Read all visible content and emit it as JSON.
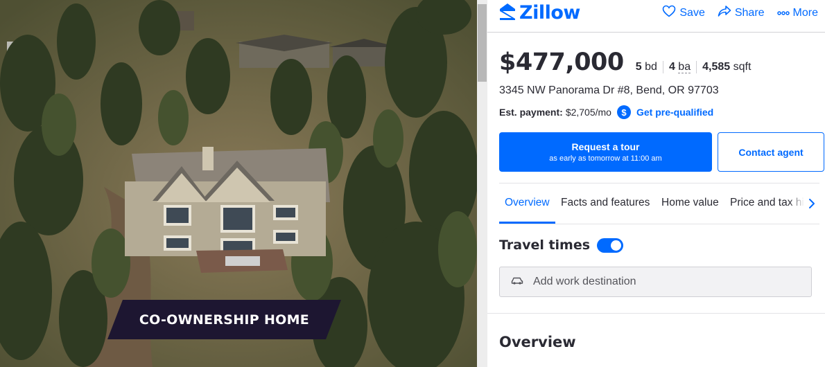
{
  "photo": {
    "badge": "CO-OWNERSHIP HOME"
  },
  "header": {
    "brand": "Zillow",
    "actions": {
      "save": "Save",
      "share": "Share",
      "more": "More"
    }
  },
  "listing": {
    "price": "$477,000",
    "beds_value": "5",
    "beds_unit": "bd",
    "baths_value": "4",
    "baths_unit": "ba",
    "sqft_value": "4,585",
    "sqft_unit": "sqft",
    "address": "3345 NW Panorama Dr #8, Bend, OR 97703"
  },
  "payment": {
    "label": "Est. payment:",
    "value": "$2,705/mo",
    "icon": "$",
    "prequal_link": "Get pre-qualified"
  },
  "cta": {
    "tour_main": "Request a tour",
    "tour_sub": "as early as tomorrow at 11:00 am",
    "contact": "Contact agent"
  },
  "tabs": [
    {
      "label": "Overview",
      "active": true
    },
    {
      "label": "Facts and features",
      "active": false
    },
    {
      "label": "Home value",
      "active": false
    },
    {
      "label": "Price and tax history",
      "active": false
    }
  ],
  "travel": {
    "title": "Travel times",
    "toggle_on": true,
    "placeholder": "Add work destination"
  },
  "overview": {
    "heading": "Overview"
  },
  "colors": {
    "accent": "#006aff",
    "text": "#2a2a33",
    "badge_bg": "#1d1631"
  },
  "icons": [
    "zillow-logo-icon",
    "heart-icon",
    "share-arrow-icon",
    "more-dots-icon",
    "dollar-icon",
    "chevron-right-icon",
    "car-icon"
  ]
}
